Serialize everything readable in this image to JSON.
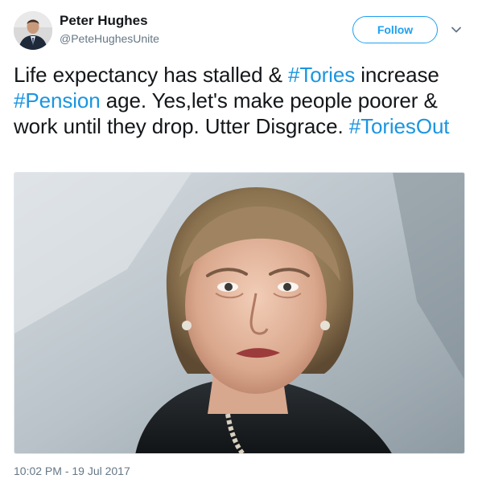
{
  "author": {
    "display_name": "Peter Hughes",
    "handle": "@PeteHughesUnite"
  },
  "actions": {
    "follow_label": "Follow"
  },
  "tweet": {
    "segments": [
      {
        "text": "Life expectancy has stalled & ",
        "hashtag": false
      },
      {
        "text": "#Tories",
        "hashtag": true
      },
      {
        "text": " increase ",
        "hashtag": false
      },
      {
        "text": "#Pension",
        "hashtag": true
      },
      {
        "text": " age. Yes,let's make people poorer & work until they drop. Utter Disgrace. ",
        "hashtag": false
      },
      {
        "text": "#ToriesOut",
        "hashtag": true
      }
    ]
  },
  "timestamp": "10:02 PM - 19 Jul 2017",
  "colors": {
    "accent": "#1da1f2",
    "hashtag": "#1b95e0",
    "muted": "#657786",
    "text": "#14171a"
  },
  "icons": {
    "caret": "chevron-down-icon"
  }
}
